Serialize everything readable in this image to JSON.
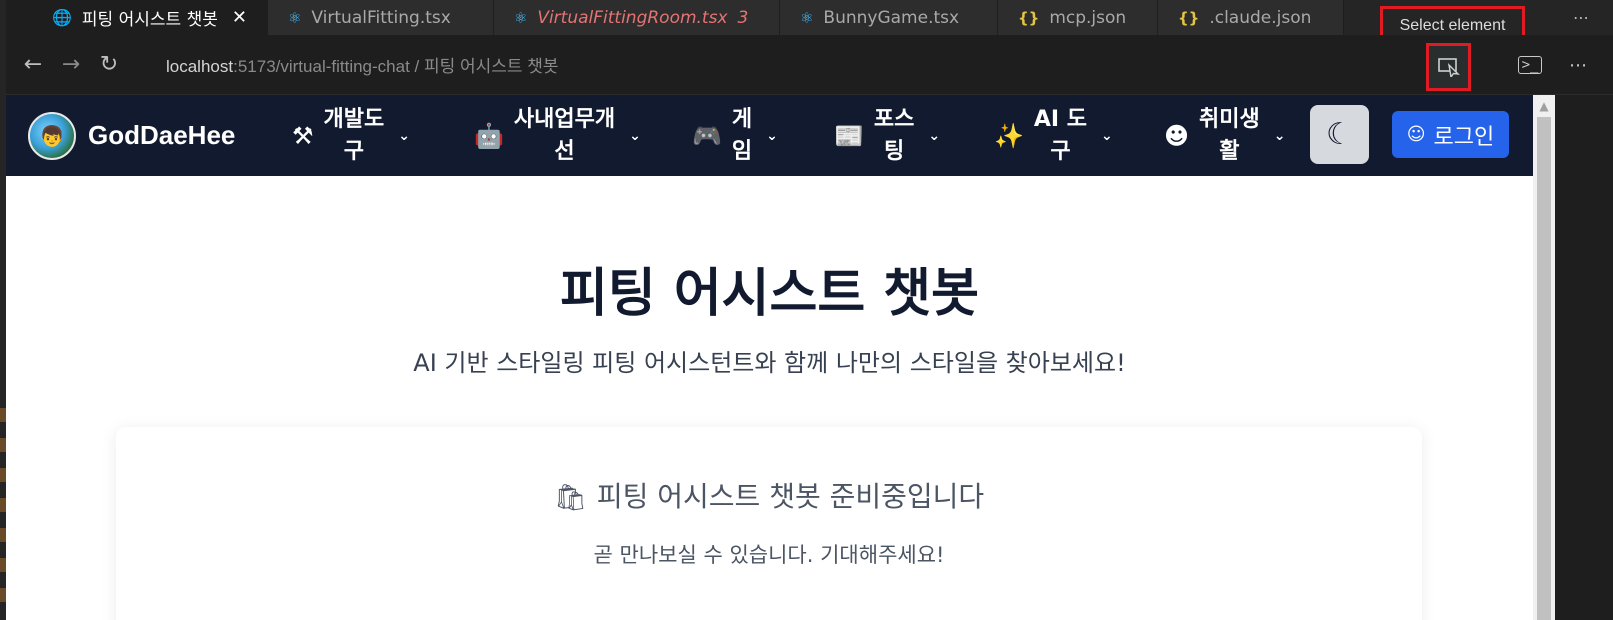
{
  "editor": {
    "tabs": [
      {
        "label": "피팅 어시스트 챗봇",
        "icon": "globe-icon",
        "active": true
      },
      {
        "label": "VirtualFitting.tsx",
        "icon": "react-icon"
      },
      {
        "label": "VirtualFittingRoom.tsx",
        "icon": "react-icon",
        "problems": "3"
      },
      {
        "label": "BunnyGame.tsx",
        "icon": "react-icon"
      },
      {
        "label": "mcp.json",
        "icon": "json-icon"
      },
      {
        "label": ".claude.json",
        "icon": "json-icon"
      }
    ],
    "tooltip": "Select element"
  },
  "browser": {
    "url_host": "localhost",
    "url_path": ":5173/virtual-fitting-chat",
    "url_sep": " / ",
    "url_title": "피팅 어시스트 챗봇"
  },
  "site": {
    "brand": "GodDaeHee",
    "menu": [
      {
        "label": "개발도\n구",
        "icon": "tools-icon"
      },
      {
        "label": "사내업무개\n선",
        "icon": "robot-icon"
      },
      {
        "label": "게\n임",
        "icon": "gamepad-icon"
      },
      {
        "label": "포스\n팅",
        "icon": "newspaper-icon"
      },
      {
        "label": "AI 도\n구",
        "icon": "magic-wand-icon"
      },
      {
        "label": "취미생\n활",
        "icon": "smile-icon"
      }
    ],
    "login_label": "로그인",
    "hero_title": "피팅 어시스트 챗봇",
    "hero_subtitle": "AI 기반 스타일링 피팅 어시스턴트와 함께 나만의 스타일을 찾아보세요!",
    "card_title": "피팅 어시스트 챗봇 준비중입니다",
    "card_desc": "곧 만나보실 수 있습니다. 기대해주세요!"
  },
  "colors": {
    "nav_bg": "#111a2e",
    "login_bg": "#2563eb",
    "highlight": "#e01b24"
  }
}
